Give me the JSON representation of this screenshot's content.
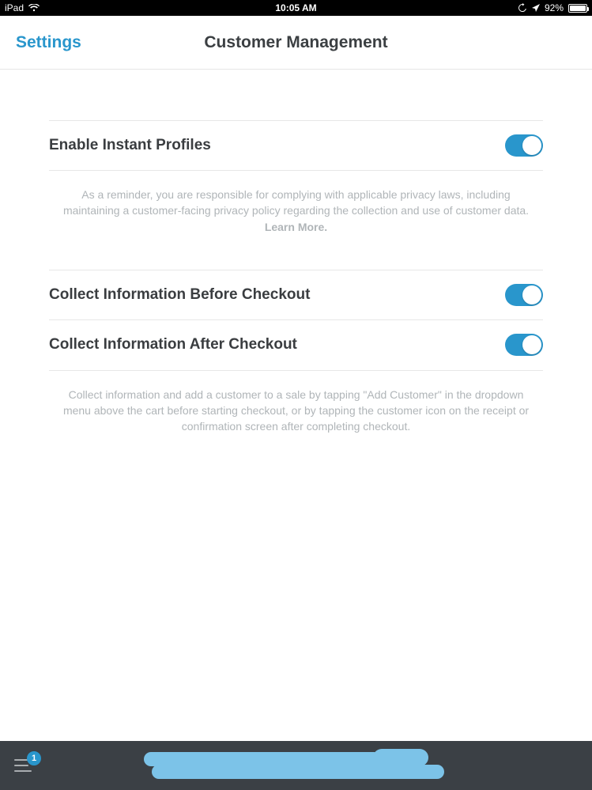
{
  "status": {
    "device": "iPad",
    "time": "10:05 AM",
    "battery_pct": "92%"
  },
  "nav": {
    "back_label": "Settings",
    "title": "Customer Management"
  },
  "rows": {
    "instant_profiles": "Enable Instant Profiles",
    "before_checkout": "Collect Information Before Checkout",
    "after_checkout": "Collect Information After Checkout"
  },
  "helpers": {
    "privacy_text": "As a reminder, you are responsible for complying with applicable privacy laws, including maintaining a customer-facing privacy policy regarding the collection and use of customer data. ",
    "privacy_link": "Learn More.",
    "collect_text": "Collect information and add a customer to a sale by tapping \"Add Customer\" in the dropdown menu above the cart before starting checkout, or by tapping the customer icon on the receipt or confirmation screen after completing checkout."
  },
  "bottom": {
    "badge": "1"
  },
  "toggles": {
    "instant_profiles": true,
    "before_checkout": true,
    "after_checkout": true
  }
}
